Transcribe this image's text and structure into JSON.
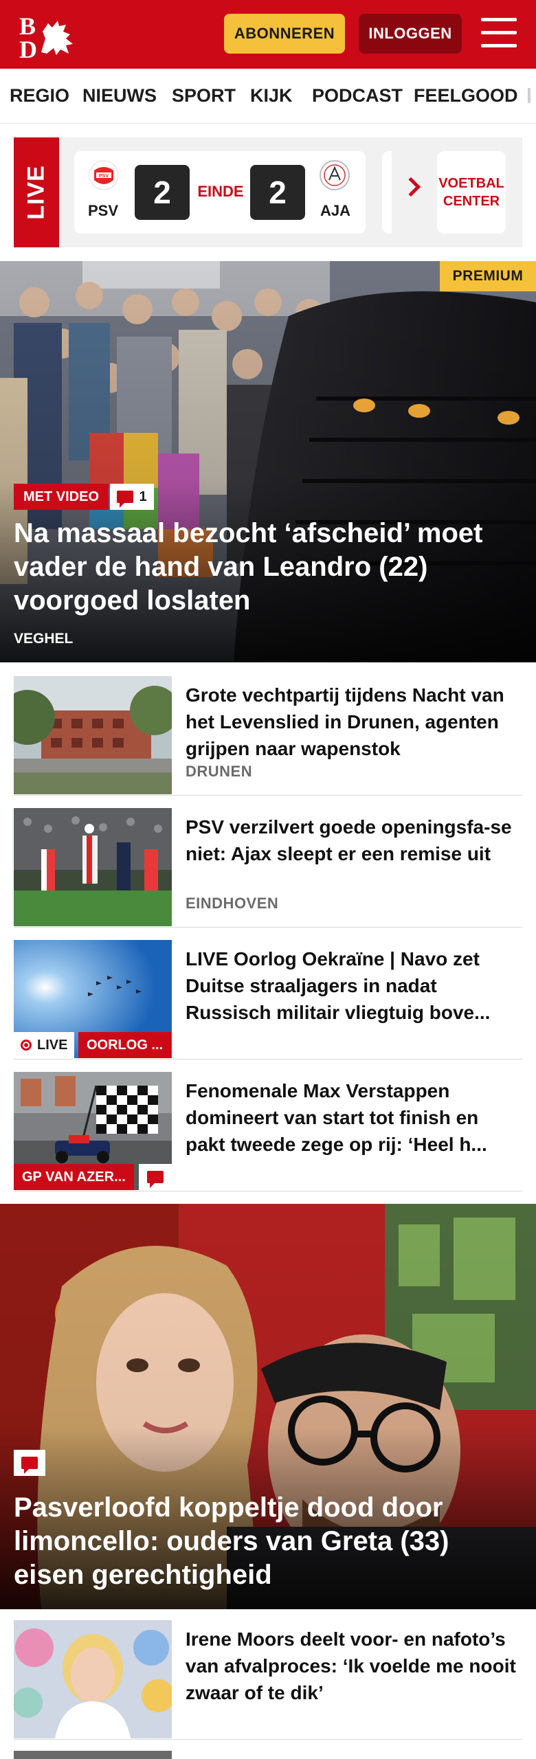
{
  "header": {
    "logo_text": "BD",
    "subscribe_label": "ABONNEREN",
    "login_label": "INLOGGEN"
  },
  "nav": {
    "items": [
      "REGIO",
      "NIEUWS",
      "SPORT",
      "KIJK",
      "PODCAST",
      "FEELGOOD"
    ]
  },
  "live": {
    "badge": "LIVE",
    "match": {
      "home": "PSV",
      "away": "AJA",
      "home_score": "2",
      "away_score": "2",
      "status": "EINDE"
    },
    "voetbal_center": [
      "VOETBAL",
      "CENTER"
    ]
  },
  "hero": {
    "premium": "PREMIUM",
    "video_badge": "MET VIDEO",
    "comments": "1",
    "title": "Na massaal bezocht ‘afscheid’ moet vader de hand van Leandro (22) voorgoed loslaten",
    "location": "VEGHEL"
  },
  "articles": [
    {
      "title": "Grote vechtpartij tijdens Nacht van het Levenslied in Drunen, agenten grijpen naar wapenstok",
      "location": "DRUNEN"
    },
    {
      "title": "PSV verzilvert goede openingsfa-se niet: Ajax sleept er een remise uit",
      "location": "EINDHOVEN"
    },
    {
      "title": "LIVE Oorlog Oekraïne | Navo zet Duitse straaljagers in nadat Russisch militair vliegtuig bove...",
      "tag_live": "LIVE",
      "tag": "OORLOG ..."
    },
    {
      "title": "Fenomenale Max Verstappen domineert van start tot finish en pakt tweede zege op rij: ‘Heel h...",
      "tag": "GP VAN AZER..."
    }
  ],
  "big_article": {
    "title": "Pasverloofd koppeltje dood door limoncello: ouders van Greta (33) eisen gerechtigheid"
  },
  "last_article": {
    "title": "Irene Moors deelt voor- en nafoto’s van afvalproces: ‘Ik voelde me nooit zwaar of te dik’"
  },
  "colors": {
    "brand_red": "#cc0a17",
    "premium_yellow": "#f5c13a",
    "login_dark_red": "#8b0710"
  }
}
